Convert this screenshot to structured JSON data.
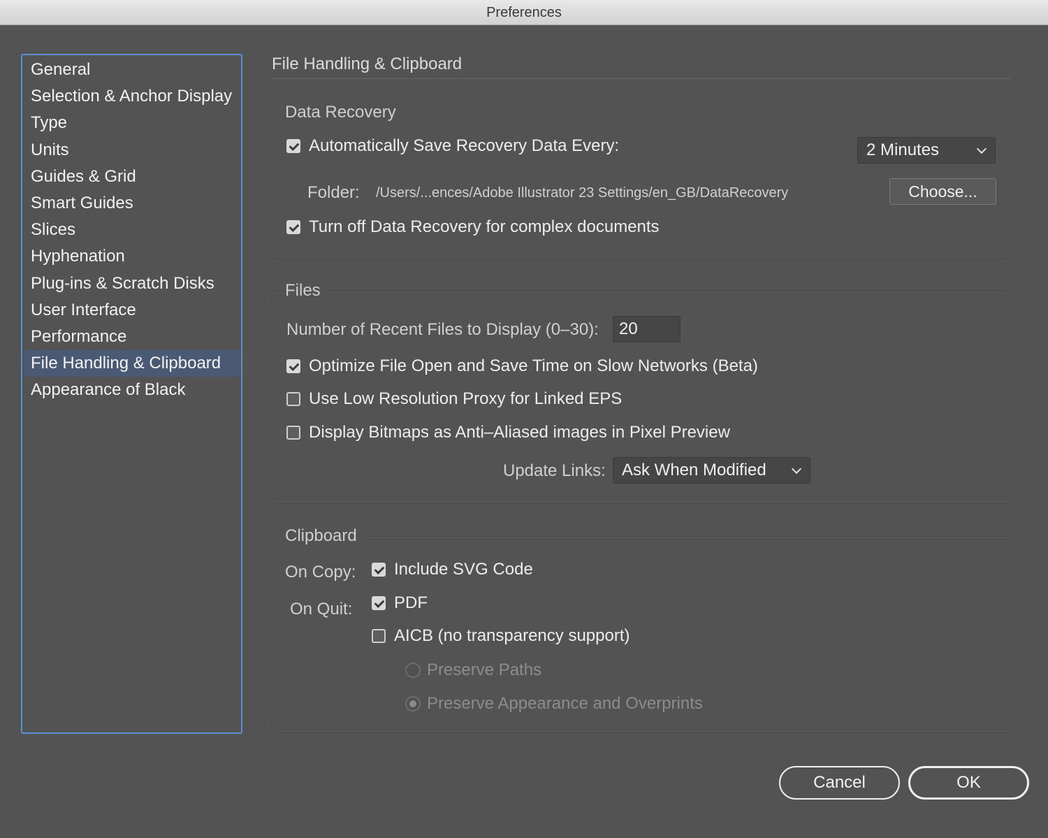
{
  "window": {
    "title": "Preferences"
  },
  "sidebar": {
    "items": [
      {
        "label": "General"
      },
      {
        "label": "Selection & Anchor Display"
      },
      {
        "label": "Type"
      },
      {
        "label": "Units"
      },
      {
        "label": "Guides & Grid"
      },
      {
        "label": "Smart Guides"
      },
      {
        "label": "Slices"
      },
      {
        "label": "Hyphenation"
      },
      {
        "label": "Plug-ins & Scratch Disks"
      },
      {
        "label": "User Interface"
      },
      {
        "label": "Performance"
      },
      {
        "label": "File Handling & Clipboard",
        "selected": true
      },
      {
        "label": "Appearance of Black"
      }
    ]
  },
  "page": {
    "heading": "File Handling & Clipboard"
  },
  "data_recovery": {
    "title": "Data Recovery",
    "auto_save": {
      "label": "Automatically Save Recovery Data Every:",
      "checked": true
    },
    "interval": {
      "value": "2 Minutes"
    },
    "folder_label": "Folder:",
    "folder_path": "/Users/...ences/Adobe Illustrator 23 Settings/en_GB/DataRecovery",
    "choose_button": "Choose...",
    "turn_off": {
      "label": "Turn off Data Recovery for complex documents",
      "checked": true
    }
  },
  "files": {
    "title": "Files",
    "recent_label": "Number of Recent Files to Display (0–30):",
    "recent_value": "20",
    "optimize": {
      "label": "Optimize File Open and Save Time on Slow Networks (Beta)",
      "checked": true
    },
    "low_res": {
      "label": "Use Low Resolution Proxy for Linked EPS",
      "checked": false
    },
    "bitmaps": {
      "label": "Display Bitmaps as Anti–Aliased images in Pixel Preview",
      "checked": false
    },
    "update_links_label": "Update Links:",
    "update_links_value": "Ask When Modified"
  },
  "clipboard": {
    "title": "Clipboard",
    "on_copy_label": "On Copy:",
    "on_quit_label": "On Quit:",
    "include_svg": {
      "label": "Include SVG Code",
      "checked": true
    },
    "pdf": {
      "label": "PDF",
      "checked": true
    },
    "aicb": {
      "label": "AICB (no transparency support)",
      "checked": false
    },
    "preserve_paths": {
      "label": "Preserve Paths",
      "selected": false
    },
    "preserve_appearance": {
      "label": "Preserve Appearance and Overprints",
      "selected": true
    }
  },
  "buttons": {
    "cancel": "Cancel",
    "ok": "OK"
  }
}
